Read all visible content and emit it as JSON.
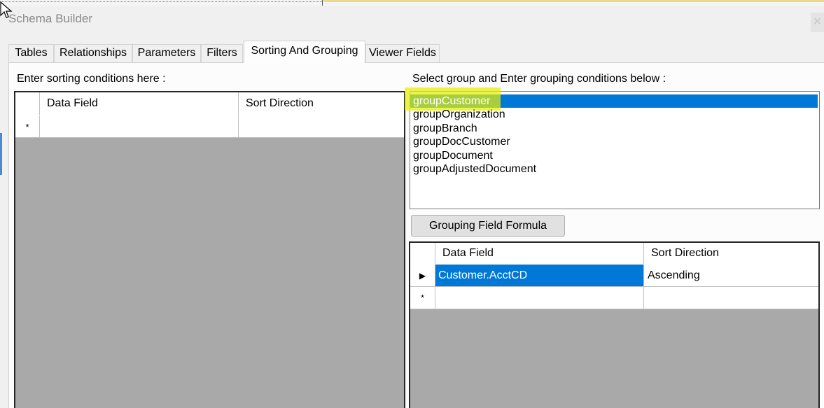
{
  "window": {
    "title": "Schema Builder",
    "close_glyph": "✕"
  },
  "tabs": [
    {
      "label": "Tables"
    },
    {
      "label": "Relationships"
    },
    {
      "label": "Parameters"
    },
    {
      "label": "Filters"
    },
    {
      "label": "Sorting And Grouping",
      "active": true
    },
    {
      "label": "Viewer Fields"
    }
  ],
  "sorting": {
    "label": "Enter sorting conditions here :",
    "columns": [
      "Data Field",
      "Sort Direction"
    ],
    "new_row_glyph": "*"
  },
  "grouping": {
    "label": "Select group and Enter grouping conditions below :",
    "groups": [
      "groupCustomer",
      "groupOrganization",
      "groupBranch",
      "groupDocCustomer",
      "groupDocument",
      "groupAdjustedDocument"
    ],
    "selected_index": 0,
    "formula_button": "Grouping Field Formula",
    "columns": [
      "Data Field",
      "Sort Direction"
    ],
    "rows": [
      {
        "data_field": "Customer.AcctCD",
        "sort_direction": "Ascending"
      }
    ],
    "current_row_glyph": "▶",
    "new_row_glyph": "*"
  },
  "colors": {
    "selection": "#0078d7",
    "highlight": "#e8f000",
    "grid_background": "#a9a9a9"
  }
}
